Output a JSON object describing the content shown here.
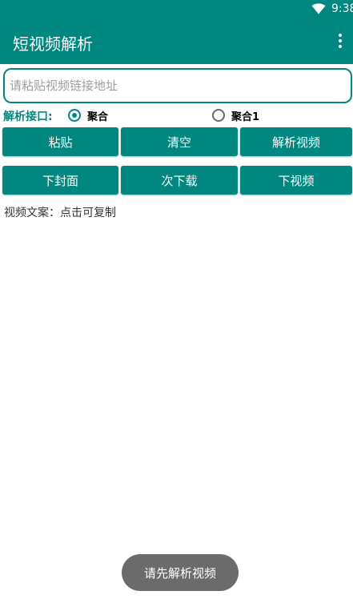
{
  "status_bar": {
    "time": "9:38",
    "wifi_icon": "wifi-icon"
  },
  "app_bar": {
    "title": "短视频解析",
    "menu_icon": "more-vert-icon"
  },
  "url_input": {
    "value": "",
    "placeholder": "请粘贴视频链接地址"
  },
  "interface": {
    "label": "解析接口:",
    "options": [
      {
        "label": "聚合",
        "checked": true
      },
      {
        "label": "聚合1",
        "checked": false
      }
    ]
  },
  "buttons_row1": [
    {
      "label": "粘贴"
    },
    {
      "label": "清空"
    },
    {
      "label": "解析视频"
    }
  ],
  "buttons_row2": [
    {
      "label": "下封面"
    },
    {
      "label": "次下载"
    },
    {
      "label": "下视频"
    }
  ],
  "caption": "视频文案：点击可复制",
  "toast": "请先解析视频",
  "colors": {
    "primary": "#00877f",
    "toast_bg": "#6b6b6b"
  }
}
